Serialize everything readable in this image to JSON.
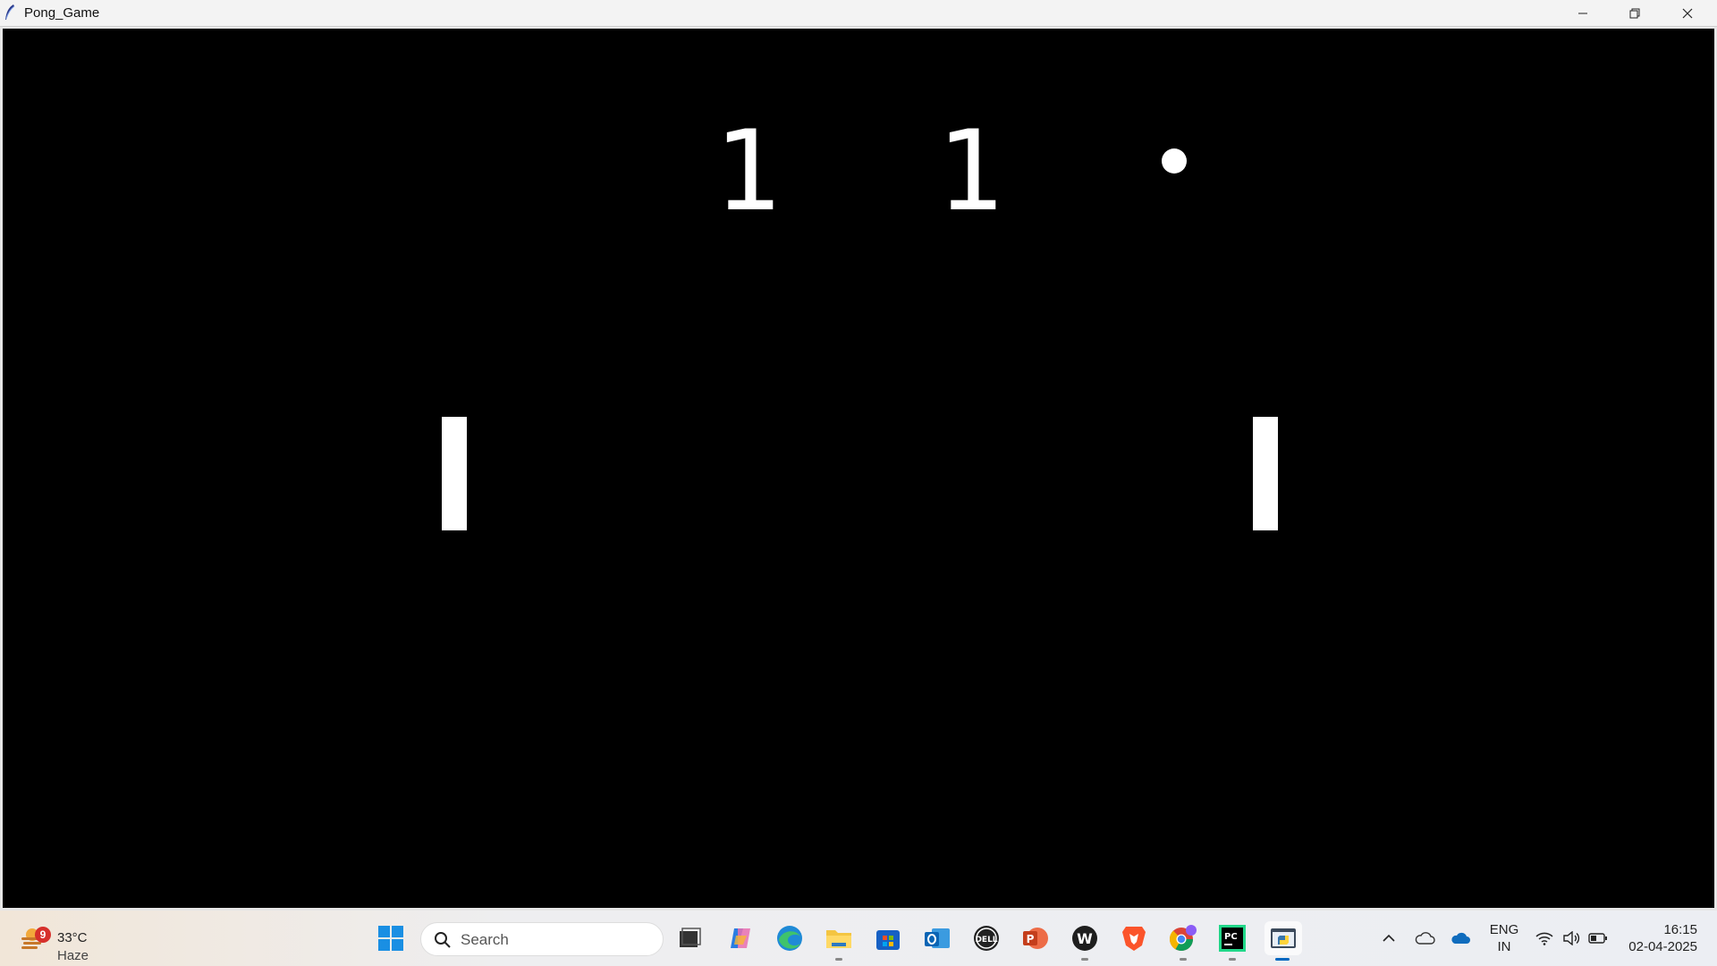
{
  "window": {
    "title": "Pong_Game",
    "icon": "feather-icon",
    "controls": [
      "minimize-icon",
      "restore-icon",
      "close-icon"
    ]
  },
  "game": {
    "score_left": "1",
    "score_right": "1",
    "background_color": "#000000",
    "foreground_color": "#ffffff"
  },
  "taskbar": {
    "weather": {
      "badge": "9",
      "temperature": "33°C",
      "condition": "Haze",
      "icon": "weather-haze-icon"
    },
    "search": {
      "placeholder": "Search"
    },
    "pinned_apps": [
      "windows-start-icon",
      "task-view-icon",
      "copilot-icon",
      "edge-icon",
      "file-explorer-icon",
      "microsoft-store-icon",
      "outlook-icon",
      "dell-icon",
      "powerpoint-icon",
      "wps-icon",
      "brave-icon",
      "chrome-icon",
      "pycharm-icon",
      "python-app-icon"
    ],
    "tray": {
      "language_line1": "ENG",
      "language_line2": "IN",
      "time": "16:15",
      "date": "02-04-2025"
    }
  }
}
